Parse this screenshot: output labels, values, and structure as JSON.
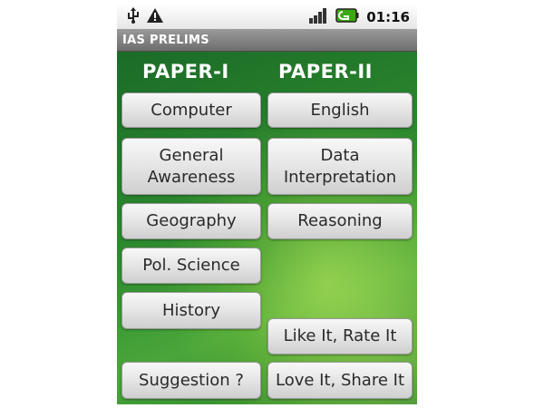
{
  "status_bar": {
    "usb_icon": "usb-icon",
    "warning_icon": "warning-icon",
    "signal_icon": "signal-bars-icon",
    "battery_icon": "battery-icon",
    "time": "01:16"
  },
  "app": {
    "title": "IAS PRELIMS"
  },
  "columns": {
    "paper1_header": "PAPER-I",
    "paper2_header": "PAPER-II"
  },
  "paper1_buttons": {
    "computer": "Computer",
    "general_awareness_line1": "General",
    "general_awareness_line2": "Awareness",
    "geography": "Geography",
    "pol_science": "Pol. Science",
    "history": "History"
  },
  "paper2_buttons": {
    "english": "English",
    "data_interpretation_line1": "Data",
    "data_interpretation_line2": "Interpretation",
    "reasoning": "Reasoning"
  },
  "footer_buttons": {
    "suggestion": "Suggestion ?",
    "like_rate": "Like It, Rate It",
    "love_share": "Love It, Share It"
  },
  "colors": {
    "background_green": "#2e8b2f",
    "title_bar_gray": "#8a8a8a",
    "button_gray": "#e5e5e5"
  }
}
